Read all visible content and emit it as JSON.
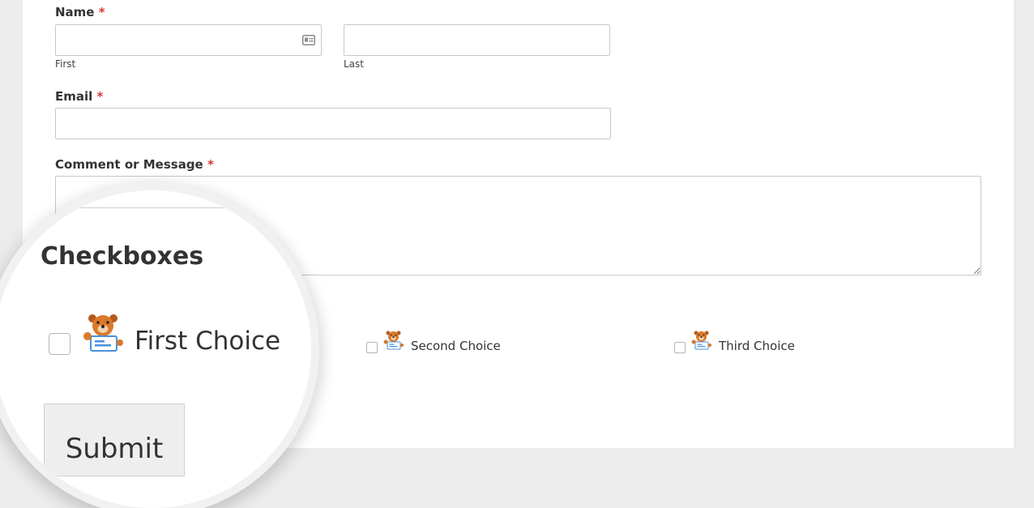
{
  "form": {
    "name": {
      "label": "Name",
      "required_mark": "*",
      "first_value": "",
      "last_value": "",
      "first_sublabel": "First",
      "last_sublabel": "Last",
      "autofill_icon": "contact-card-icon"
    },
    "email": {
      "label": "Email",
      "required_mark": "*",
      "value": ""
    },
    "comment": {
      "label": "Comment or Message",
      "required_mark": "*",
      "value": ""
    },
    "checkboxes": {
      "label": "Checkboxes",
      "choices": [
        {
          "label": "First Choice",
          "checked": false,
          "icon": "bear-mascot-icon"
        },
        {
          "label": "Second Choice",
          "checked": false,
          "icon": "bear-mascot-icon"
        },
        {
          "label": "Third Choice",
          "checked": false,
          "icon": "bear-mascot-icon"
        }
      ]
    },
    "submit_label": "Submit"
  },
  "colors": {
    "required": "#d63637",
    "background": "#ececec",
    "card": "#ffffff",
    "border": "#c8c8c8"
  }
}
